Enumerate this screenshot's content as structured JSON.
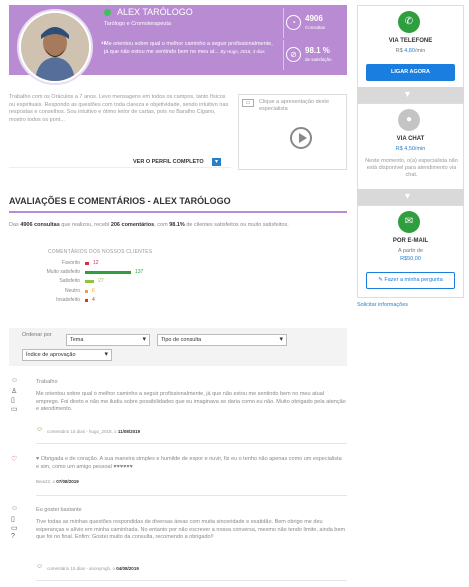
{
  "profile": {
    "name": "ALEX TARÓLOGO",
    "subtitle": "Tarólogo e Cromoterapeuta",
    "quote_mark": "“",
    "quote": "Me orientou sobre qual o melhor caminho a seguir profissionalmente, já que não estou me sentindo bem no meu at...",
    "quote_author": "By Hugo, 2018, 3 dias",
    "online_color": "#3cc35a",
    "header_color": "#b98bd3"
  },
  "stats": [
    {
      "icon": "chart-icon",
      "glyph": "◔",
      "value": "4906",
      "label": "Consultas"
    },
    {
      "icon": "percent-icon",
      "glyph": "⊘",
      "value": "98.1 %",
      "label": "de satisfação"
    }
  ],
  "bio": {
    "text": "Trabalho com os Oráculos a 7 anos. Levo mensagens em todos os campos, tanto físicos ou espirituais. Respondo as questões com toda clareza e objetividade, sendo intuitivo nas respostas e conselhos. Sou intuitivo e ótimo leitor de cartas, pois no Baralho Cigano, mostro todos os pont...",
    "more_label": "VER O PERFIL COMPLETO",
    "more_glyph": "▾"
  },
  "video": {
    "label": "Clique a apresentação deste especialista",
    "icon_glyph": "▭"
  },
  "contact": {
    "phone": {
      "title": "VIA TELEFONE",
      "price_prefix": "R$ ",
      "price": "4,80",
      "price_suffix": "/min",
      "button": "LIGAR AGORA",
      "glyph": "✆"
    },
    "chat": {
      "title": "VIA CHAT",
      "price": "R$ 4,50/min",
      "note": "Neste momento, o(a) especialista não está disponível para atendimento via chat.",
      "glyph": "●"
    },
    "email": {
      "title": "POR E-MAIL",
      "price_prefix": "A partir de",
      "price": "R$50,00",
      "button": "Fazer a minha pergunta",
      "glyph": "✉"
    },
    "request_info": "Solicitar informações"
  },
  "reviews": {
    "title": "AVALIAÇÕES E COMENTÁRIOS - ALEX TARÓLOGO",
    "summary": {
      "pre": "Das ",
      "consultas": "4906 consultas",
      "mid1": " que realizou, recebi ",
      "comentarios": "206 comentários",
      "mid2": ", com ",
      "pct": "98.1%",
      "post": " de clientes satisfeitos ou muito satisfeitos."
    }
  },
  "chart_data": {
    "type": "bar",
    "title": "COMENTÁRIOS DOS NOSSOS CLIENTES",
    "categories": [
      "Favorito",
      "Muito satisfeito",
      "Satisfeito",
      "Neutro",
      "Insatisfeito"
    ],
    "values": [
      12,
      137,
      27,
      6,
      4
    ],
    "colors": [
      "#cc3344",
      "#2e9e3e",
      "#8cc63f",
      "#f0a030",
      "#e03030"
    ],
    "xlim": [
      0,
      137
    ]
  },
  "filters": {
    "label": "Ordenar por",
    "tema": "Tema",
    "tipo": "Tipo de consulta",
    "indice": "Índice de aprovação"
  },
  "review_items": [
    {
      "title": "Trabalho",
      "text": "Me orientou sobre qual o melhor caminho a seguir profissionalmente, já que não estou me sentindo bem no meu atual emprego. Foi direto e não me iludiu sobre possibilidades que eu imaginava se daria como eu não. Muito obrigado pela atenção e atendimento.",
      "meta_pre": "comentário 16 dias - hugo_2018, o ",
      "meta_date": "11/08/2019"
    },
    {
      "title": "",
      "text": "♥ Obrigada e de coração. A sua maneira simples e humilde de expor e ouvir, fiz eu o tenho não apenas como um especialista e sim, como um amigo pessoal ♥♥♥♥♥♥",
      "meta_pre": "Beia22, o ",
      "meta_date": "07/08/2019"
    },
    {
      "title": "Eu gostei bastante",
      "text": "Tive todas as minhas questões respondidas de diversas áreas com muita sinceridade e exatidão. Bem obrigo me deu esperanças e alívio em minha caminhada. No entanto por não escrever a nossa conversa, mesmo não tendo limite, ainda bem que foi no final. Enfim: Gostei muito da consulta, recomendo a obrigado!!",
      "meta_pre": "comentário 15 dias - anonymgh, o ",
      "meta_date": "04/08/2019"
    }
  ]
}
